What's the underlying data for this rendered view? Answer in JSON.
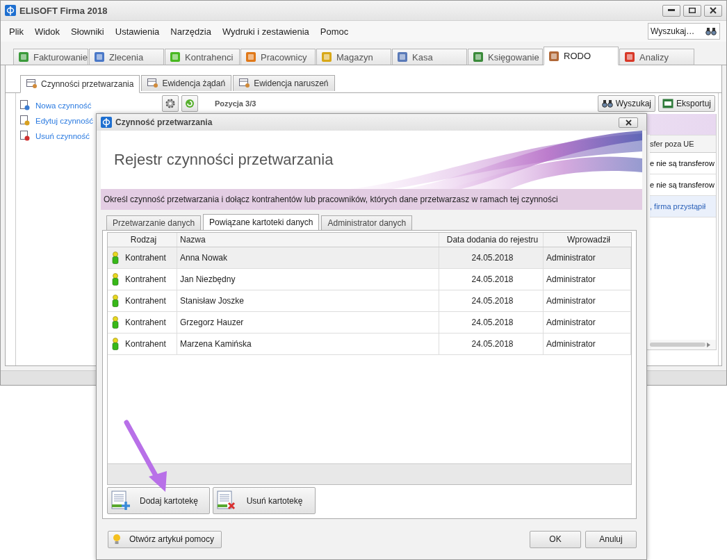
{
  "window": {
    "title": "ELISOFT Firma 2018"
  },
  "menu": [
    "Plik",
    "Widok",
    "Słowniki",
    "Ustawienia",
    "Narzędzia",
    "Wydruki i zestawienia",
    "Pomoc"
  ],
  "search": {
    "placeholder": "Wyszukaj…"
  },
  "module_tabs": [
    {
      "label": "Fakturowanie",
      "selected": false
    },
    {
      "label": "Zlecenia",
      "selected": false
    },
    {
      "label": "Kontrahenci",
      "selected": false
    },
    {
      "label": "Pracownicy",
      "selected": false
    },
    {
      "label": "Magazyn",
      "selected": false
    },
    {
      "label": "Kasa",
      "selected": false
    },
    {
      "label": "Księgowanie",
      "selected": false
    },
    {
      "label": "RODO",
      "selected": true
    },
    {
      "label": "Analizy",
      "selected": false
    }
  ],
  "sub_tabs": [
    {
      "label": "Czynności przetwarzania",
      "selected": true
    },
    {
      "label": "Ewidencja żądań",
      "selected": false
    },
    {
      "label": "Ewidencja naruszeń",
      "selected": false
    }
  ],
  "actions": [
    "Nowa czynność",
    "Edytuj czynność",
    "Usuń czynność"
  ],
  "toolbar": {
    "position": "Pozycja 3/3",
    "buttons": [
      "Wyszukaj",
      "Eksportuj"
    ]
  },
  "background_grid": {
    "column_1": "sfer poza UE",
    "rows": [
      {
        "text": "e nie są transferow",
        "selected": false
      },
      {
        "text": "e nie są transferow",
        "selected": false
      },
      {
        "text": ", firma przystąpił",
        "selected": true
      }
    ]
  },
  "dialog": {
    "title": "Czynność przetwarzania",
    "heading": "Rejestr czynności przetwarzania",
    "instruction": "Określ czynność przetwarzania i dołącz kontrahentów lub pracowników, których dane przetwarzasz w ramach tej czynności",
    "tabs": [
      {
        "label": "Przetwarzanie danych",
        "selected": false
      },
      {
        "label": "Powiązane kartoteki danych",
        "selected": true
      },
      {
        "label": "Administrator danych",
        "selected": false
      }
    ],
    "table": {
      "columns": [
        "Rodzaj",
        "Nazwa",
        "Data dodania do rejestru",
        "Wprowadził"
      ],
      "rows": [
        {
          "kind": "Kontrahent",
          "name": "Anna Nowak",
          "date": "24.05.2018",
          "entered_by": "Administrator",
          "selected": true
        },
        {
          "kind": "Kontrahent",
          "name": "Jan Niezbędny",
          "date": "24.05.2018",
          "entered_by": "Administrator",
          "selected": false
        },
        {
          "kind": "Kontrahent",
          "name": "Stanisław Joszke",
          "date": "24.05.2018",
          "entered_by": "Administrator",
          "selected": false
        },
        {
          "kind": "Kontrahent",
          "name": "Grzegorz Hauzer",
          "date": "24.05.2018",
          "entered_by": "Administrator",
          "selected": false
        },
        {
          "kind": "Kontrahent",
          "name": "Marzena Kamińska",
          "date": "24.05.2018",
          "entered_by": "Administrator",
          "selected": false
        }
      ]
    },
    "row_buttons": [
      "Dodaj kartotekę",
      "Usuń kartotekę"
    ],
    "help_button": "Otwórz artykuł pomocy",
    "buttons": [
      "OK",
      "Anuluj"
    ]
  }
}
